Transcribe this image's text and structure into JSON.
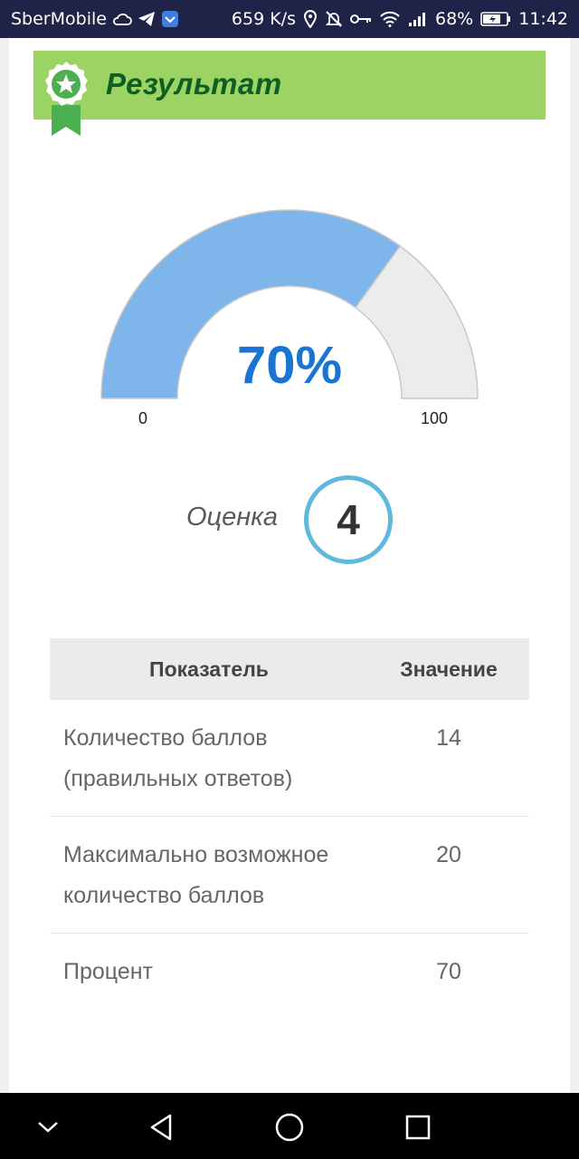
{
  "status_bar": {
    "carrier": "SberMobile",
    "speed": "659 K/s",
    "battery_percent": "68%",
    "time": "11:42",
    "background": "#1f2347"
  },
  "result": {
    "title": "Результат",
    "banner_color": "#9bd462",
    "title_color": "#0f5e24"
  },
  "gauge": {
    "value_label": "70%",
    "value": 70,
    "min_label": "0",
    "max_label": "100",
    "fill_color": "#7eb5ea",
    "track_color": "#ececec"
  },
  "grade": {
    "label": "Оценка",
    "value": "4",
    "ring_color": "#5fb9dc"
  },
  "table": {
    "headers": [
      "Показатель",
      "Значение"
    ],
    "rows": [
      {
        "name": "Количество баллов (правильных ответов)",
        "value": "14"
      },
      {
        "name": "Максимально возможное количество баллов",
        "value": "20"
      },
      {
        "name": "Процент",
        "value": "70"
      }
    ]
  },
  "nav_bar": {
    "icons": [
      "collapse-icon",
      "back-icon",
      "home-icon",
      "recents-icon"
    ]
  }
}
